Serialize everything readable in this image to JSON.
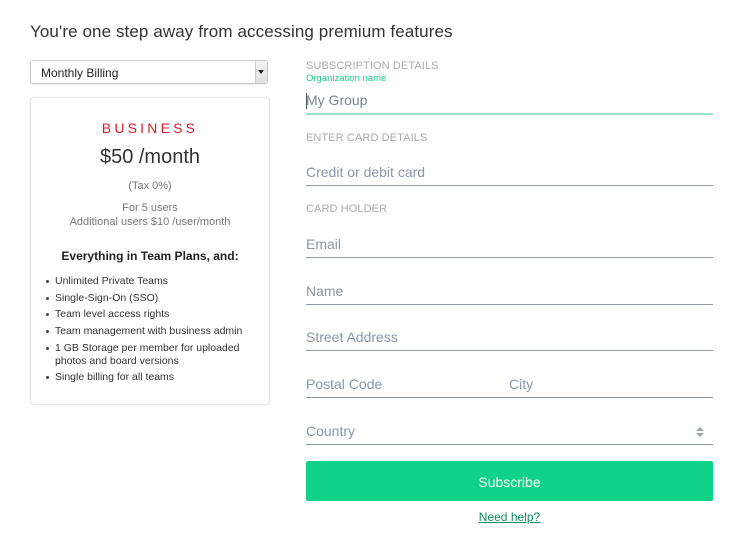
{
  "page": {
    "title": "You're one step away from accessing premium features"
  },
  "billing": {
    "selected": "Monthly Billing"
  },
  "plan": {
    "name": "BUSINESS",
    "price": "$50 /month",
    "tax": "(Tax 0%)",
    "users_line1": "For 5 users",
    "users_line2": "Additional users $10 /user/month",
    "features_heading": "Everything in Team Plans, and:",
    "features": [
      "Unlimited Private Teams",
      "Single-Sign-On (SSO)",
      "Team level access rights",
      "Team management with business admin",
      "1 GB Storage per member for uploaded photos and board versions",
      "Single billing for all teams"
    ],
    "accent_color": "#d0202e"
  },
  "form": {
    "subscription_section": "SUBSCRIPTION DETAILS",
    "org_label": "Organization name",
    "org_value": "My Group",
    "card_section": "ENTER CARD DETAILS",
    "card_placeholder": "Credit or debit card",
    "holder_section": "CARD HOLDER",
    "email_placeholder": "Email",
    "name_placeholder": "Name",
    "street_placeholder": "Street Address",
    "postal_placeholder": "Postal Code",
    "city_placeholder": "City",
    "country_placeholder": "Country",
    "subscribe_label": "Subscribe",
    "help_label": "Need help?",
    "accent_color": "#0fd187"
  }
}
